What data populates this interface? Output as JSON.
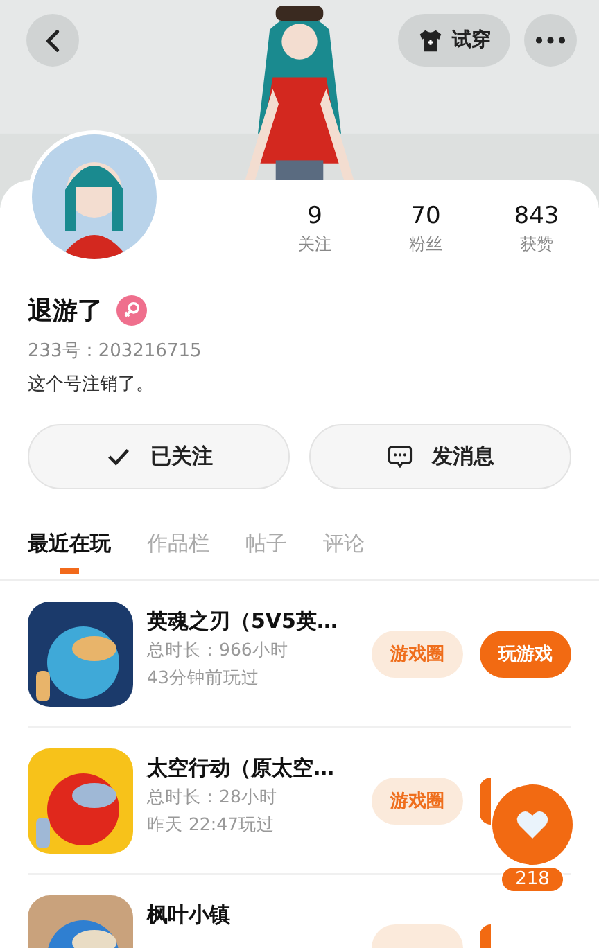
{
  "header": {
    "try_on": "试穿"
  },
  "stats": [
    {
      "value": "9",
      "label": "关注"
    },
    {
      "value": "70",
      "label": "粉丝"
    },
    {
      "value": "843",
      "label": "获赞"
    }
  ],
  "profile": {
    "name": "退游了",
    "female": true,
    "id": "233号：203216715",
    "bio": "这个号注销了。"
  },
  "actions": [
    {
      "kind": "followed",
      "label": "已关注"
    },
    {
      "kind": "message",
      "label": "发消息"
    }
  ],
  "tabs": [
    {
      "label": "最近在玩",
      "selected": true
    },
    {
      "label": "作品栏",
      "selected": false
    },
    {
      "label": "帖子",
      "selected": false
    },
    {
      "label": "评论",
      "selected": false
    }
  ],
  "games": [
    {
      "title": "英魂之刃（5V5英…",
      "duration": "总时长：966小时",
      "last_played": "43分钟前玩过",
      "circle": "游戏圈",
      "play": "玩游戏"
    },
    {
      "title": "太空行动（原太空…",
      "duration": "总时长：28小时",
      "last_played": "昨天 22:47玩过",
      "circle": "游戏圈"
    },
    {
      "title": "枫叶小镇"
    }
  ],
  "like_fab": {
    "count": "218"
  }
}
